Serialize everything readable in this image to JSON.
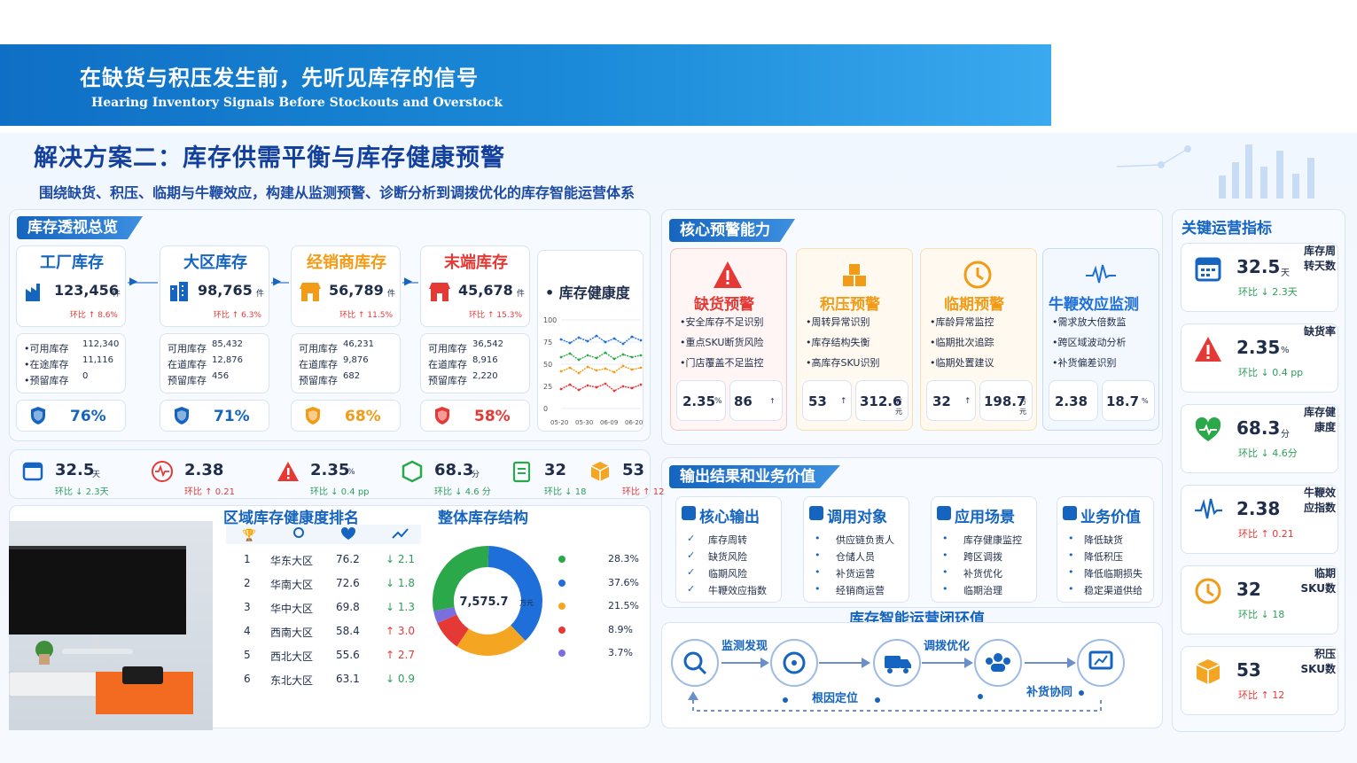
{
  "banner": {
    "title": "在缺货与积压发生前，先听见库存的信号",
    "subtitle": "Hearing Inventory Signals Before Stockouts and Overstock"
  },
  "heading": {
    "title": "解决方案二：库存供需平衡与库存健康预警",
    "subtitle": "围绕缺货、积压、临期与牛鞭效应，构建从监测预警、诊断分析到调拨优化的库存智能运营体系"
  },
  "overview": {
    "tag": "库存透视总览",
    "stages": [
      {
        "name": "工厂库存",
        "value": "123,456",
        "unit": "件",
        "mom": "环比 ↑ 8.6%",
        "avail_label": "•可用库存",
        "avail": "112,340",
        "transit_label": "•在途库存",
        "transit": "11,116",
        "reserve_label": "•预留库存",
        "reserve": "0",
        "health": "76%"
      },
      {
        "name": "大区库存",
        "value": "98,765",
        "unit": "件",
        "mom": "环比 ↑ 6.3%",
        "avail_label": "可用库存",
        "avail": "85,432",
        "transit_label": "在道库存",
        "transit": "12,876",
        "reserve_label": "预留库存",
        "reserve": "456",
        "health": "71%"
      },
      {
        "name": "经销商库存",
        "value": "56,789",
        "unit": "件",
        "mom": "环比 ↑ 11.5%",
        "avail_label": "可用库存",
        "avail": "46,231",
        "transit_label": "在道库存",
        "transit": "9,876",
        "reserve_label": "预留库存",
        "reserve": "682",
        "health": "68%"
      },
      {
        "name": "末端库存",
        "value": "45,678",
        "unit": "件",
        "mom": "环比 ↑ 15.3%",
        "avail_label": "可用库存",
        "avail": "36,542",
        "transit_label": "在道库存",
        "transit": "8,916",
        "reserve_label": "预留库存",
        "reserve": "2,220",
        "health": "58%"
      }
    ],
    "health_chart": {
      "title": "库存健康度",
      "yticks": [
        "100",
        "75",
        "50",
        "25",
        "0"
      ],
      "xticks": [
        "05-20",
        "05-30",
        "06-09",
        "06-20"
      ],
      "series": [
        {
          "color": "#1e6fd9",
          "values": [
            78,
            74,
            80,
            76,
            82,
            75,
            79,
            73,
            81,
            77
          ]
        },
        {
          "color": "#2aa84a",
          "values": [
            58,
            62,
            55,
            60,
            57,
            63,
            56,
            61,
            58,
            60
          ]
        },
        {
          "color": "#f29b17",
          "values": [
            42,
            46,
            40,
            47,
            43,
            45,
            41,
            48,
            44,
            46
          ]
        },
        {
          "color": "#e53935",
          "values": [
            22,
            27,
            21,
            26,
            24,
            28,
            20,
            25,
            23,
            27
          ]
        }
      ]
    }
  },
  "metrics_row": [
    {
      "value": "32.5",
      "unit": "天",
      "mom": "环比 ↓ 2.3天",
      "dir": "dn"
    },
    {
      "value": "2.38",
      "unit": "",
      "mom": "环比 ↑ 0.21",
      "dir": "up"
    },
    {
      "value": "2.35",
      "unit": "%",
      "mom": "环比 ↓ 0.4 pp",
      "dir": "dn"
    },
    {
      "value": "68.3",
      "unit": "分",
      "mom": "环比 ↓ 4.6 分",
      "dir": "dn"
    },
    {
      "value": "32",
      "unit": "",
      "mom": "环比 ↓ 18",
      "dir": "dn"
    },
    {
      "value": "53",
      "unit": "",
      "mom": "环比 ↑ 12",
      "dir": "up"
    }
  ],
  "ranking": {
    "title": "区域库存健康度排名",
    "rows": [
      {
        "rank": "1",
        "region": "华东大区",
        "score": "76.2",
        "change": "↓ 2.1",
        "dir": "dn"
      },
      {
        "rank": "2",
        "region": "华南大区",
        "score": "72.6",
        "change": "↓ 1.8",
        "dir": "dn"
      },
      {
        "rank": "3",
        "region": "华中大区",
        "score": "69.8",
        "change": "↓ 1.3",
        "dir": "dn"
      },
      {
        "rank": "4",
        "region": "西南大区",
        "score": "58.4",
        "change": "↑ 3.0",
        "dir": "up"
      },
      {
        "rank": "5",
        "region": "西北大区",
        "score": "55.6",
        "change": "↑ 2.7",
        "dir": "up"
      },
      {
        "rank": "6",
        "region": "东北大区",
        "score": "63.1",
        "change": "↓ 0.9",
        "dir": "dn"
      }
    ]
  },
  "chart_data": {
    "type": "pie",
    "title": "整体库存结构",
    "center_value": "7,575.7",
    "center_unit": "万元",
    "slices": [
      {
        "color": "#1e6fd9",
        "value": 37.6,
        "label": "37.6%"
      },
      {
        "color": "#f4a623",
        "value": 21.5,
        "label": "21.5%"
      },
      {
        "color": "#e53935",
        "value": 8.9,
        "label": "8.9%"
      },
      {
        "color": "#7b6fe0",
        "value": 3.7,
        "label": "3.7%"
      },
      {
        "color": "#2aa84a",
        "value": 28.3,
        "label": "28.3%"
      }
    ],
    "legend_order": [
      {
        "color": "#2aa84a",
        "label": "28.3%"
      },
      {
        "color": "#1e6fd9",
        "label": "37.6%"
      },
      {
        "color": "#f4a623",
        "label": "21.5%"
      },
      {
        "color": "#e53935",
        "label": "8.9%"
      },
      {
        "color": "#7b6fe0",
        "label": "3.7%"
      }
    ]
  },
  "alerts": {
    "tag": "核心预警能力",
    "cards": [
      {
        "title": "缺货预警",
        "color": "#e53935",
        "items": [
          "•安全库存不足识别",
          "•重点SKU断货风险",
          "•门店覆盖不足监控"
        ],
        "m1": "2.35",
        "u1": "%",
        "m2": "86",
        "u2": "↑"
      },
      {
        "title": "积压预警",
        "color": "#f29b17",
        "items": [
          "•周转异常识别",
          "•库存结构失衡",
          "•高库存SKU识别"
        ],
        "m1": "53",
        "u1": "↑",
        "m2": "312.6",
        "u2": "万元"
      },
      {
        "title": "临期预警",
        "color": "#f29b17",
        "items": [
          "•库龄异常监控",
          "•临期批次追踪",
          "•临期处置建议"
        ],
        "m1": "32",
        "u1": "↑",
        "m2": "198.7",
        "u2": "万元"
      },
      {
        "title": "牛鞭效应监测",
        "color": "#1e6fd9",
        "items": [
          "•需求放大倍数监",
          "•跨区域波动分析",
          "•补货偏差识别"
        ],
        "m1": "2.38",
        "u1": "",
        "m2": "18.7",
        "u2": "%"
      }
    ]
  },
  "output": {
    "tag": "输出结果和业务价值",
    "cols": [
      {
        "title": "核心输出",
        "items": [
          "库存周转",
          "缺货风险",
          "临期风险",
          "牛鞭效应指数"
        ],
        "mark": "✓"
      },
      {
        "title": "调用对象",
        "items": [
          "供应链负责人",
          "仓储人员",
          "补货运营",
          "经销商运营"
        ],
        "mark": "•"
      },
      {
        "title": "应用场景",
        "items": [
          "库存健康监控",
          "跨区调拨",
          "补货优化",
          "临期治理"
        ],
        "mark": "•"
      },
      {
        "title": "业务价值",
        "items": [
          "降低缺货",
          "降低积压",
          "降低临期损失",
          "稳定渠道供给"
        ],
        "mark": "•"
      }
    ]
  },
  "loop": {
    "title": "库存智能运营闭环值",
    "steps": [
      "监测发现",
      "根因定位",
      "调拨优化",
      "补货协同"
    ]
  },
  "kpi": {
    "title": "关键运营指标",
    "items": [
      {
        "value": "32.5",
        "unit": "天",
        "label": "库存周转天数",
        "mom": "环比 ↓ 2.3天",
        "dir": "dn"
      },
      {
        "value": "2.35",
        "unit": "%",
        "label": "缺货率",
        "mom": "环比 ↓ 0.4 pp",
        "dir": "dn"
      },
      {
        "value": "68.3",
        "unit": "分",
        "label": "库存健康度",
        "mom": "环比 ↓ 4.6分",
        "dir": "dn"
      },
      {
        "value": "2.38",
        "unit": "",
        "label": "牛鞭效应指数",
        "mom": "环比 ↑ 0.21",
        "dir": "up"
      },
      {
        "value": "32",
        "unit": "",
        "label": "临期SKU数",
        "mom": "环比 ↓ 18",
        "dir": "dn"
      },
      {
        "value": "53",
        "unit": "",
        "label": "积压SKU数",
        "mom": "环比 ↑ 12",
        "dir": "up"
      }
    ]
  }
}
